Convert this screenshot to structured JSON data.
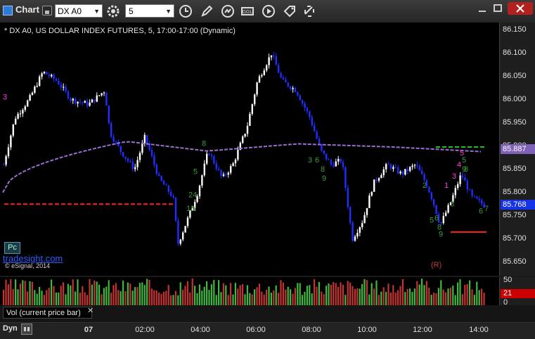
{
  "toolbar": {
    "app_title": "Chart",
    "symbol": "DX A0",
    "interval": "5",
    "icons": [
      "symbol-settings-icon",
      "clock-icon",
      "pencil-icon",
      "refresh-icon",
      "ggl-icon",
      "play-icon",
      "tag-icon",
      "link-icon"
    ]
  },
  "chart": {
    "header": "* DX A0, US DOLLAR INDEX FUTURES, 5, 17:00-17:00 (Dynamic)",
    "watermark": "tradesight.com",
    "copyright": "© eSignal, 2014",
    "pc_label": "Pc",
    "r_label": "(R)",
    "price_ticks": [
      "86.150",
      "86.100",
      "86.050",
      "86.000",
      "85.950",
      "85.900",
      "85.850",
      "85.800",
      "85.750",
      "85.700",
      "85.650"
    ],
    "ma_value": "85.887",
    "last_price": "85.768",
    "colors": {
      "up": "#ffffff",
      "down": "#1f2dff",
      "ma": "#9a6fd0",
      "red_line": "#ff2020",
      "green_line": "#20c020",
      "last_price_bg": "#1733e6",
      "ma_tag_bg": "#7f62b8"
    }
  },
  "chart_data": {
    "type": "candlestick",
    "ylim": [
      85.63,
      86.16
    ],
    "session_times": [
      "07",
      "02:00",
      "04:00",
      "06:00",
      "08:00",
      "10:00",
      "12:00",
      "14:00"
    ],
    "ma_last": 85.887,
    "last": 85.768,
    "support_line": 85.775,
    "resistance_line": 85.898,
    "stop_line": 85.715,
    "td_labels": [
      {
        "t": "3",
        "c": "#ff3fd8"
      },
      {
        "t": "1",
        "c": "#ff3fd8"
      },
      {
        "t": "3",
        "c": "#ff3fd8"
      },
      {
        "t": "4",
        "c": "#ff3fd8"
      },
      {
        "t": "5",
        "c": "#ff3fd8"
      },
      {
        "t": "8",
        "c": "#3d9c3d"
      },
      {
        "t": "5",
        "c": "#3d9c3d"
      },
      {
        "t": "24",
        "c": "#3d9c3d"
      },
      {
        "t": "13",
        "c": "#3d9c3d"
      },
      {
        "t": "3",
        "c": "#3d9c3d"
      },
      {
        "t": "6",
        "c": "#3d9c3d"
      },
      {
        "t": "8",
        "c": "#3d9c3d"
      },
      {
        "t": "9",
        "c": "#3d9c3d"
      },
      {
        "t": "5",
        "c": "#3d9c3d"
      },
      {
        "t": "6",
        "c": "#3d9c3d"
      },
      {
        "t": "8",
        "c": "#3d9c3d"
      },
      {
        "t": "9",
        "c": "#3d9c3d"
      },
      {
        "t": "2",
        "c": "#3d9c3d"
      },
      {
        "t": "3",
        "c": "#3d9c3d"
      },
      {
        "t": "5",
        "c": "#3d9c3d"
      },
      {
        "t": "7",
        "c": "#3d9c3d"
      },
      {
        "t": "8",
        "c": "#3d9c3d"
      },
      {
        "t": "9",
        "c": "#3d9c3d"
      },
      {
        "t": "6",
        "c": "#3d9c3d"
      }
    ]
  },
  "volume": {
    "label": "Vol (current price bar)",
    "ticks": [
      "50",
      "0"
    ],
    "current": "21"
  },
  "footer": {
    "dyn": "Dyn",
    "times": [
      "07",
      "02:00",
      "04:00",
      "06:00",
      "08:00",
      "10:00",
      "12:00",
      "14:00"
    ]
  }
}
